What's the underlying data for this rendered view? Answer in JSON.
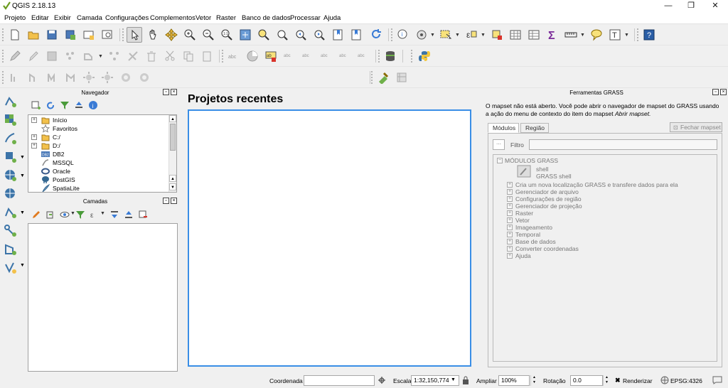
{
  "window": {
    "title": "QGIS 2.18.13",
    "minimize": "—",
    "restore": "❐",
    "close": "✕"
  },
  "menu": [
    "Projeto",
    "Editar",
    "Exibir",
    "Camada",
    "Configurações",
    "Complementos",
    "Vetor",
    "Raster",
    "Banco de dados",
    "Processar",
    "Ajuda"
  ],
  "navegador": {
    "title": "Navegador",
    "items": [
      "Início",
      "Favoritos",
      "C:/",
      "D:/",
      "DB2",
      "MSSQL",
      "Oracle",
      "PostGIS",
      "SpatiaLite"
    ]
  },
  "camadas": {
    "title": "Camadas"
  },
  "recent": {
    "title": "Projetos recentes"
  },
  "grass": {
    "title": "Ferramentas GRASS",
    "description": "O mapset não está aberto. Você pode abrir o navegador de mapset do GRASS usando a ação do menu de contexto do item do mapset",
    "description_link": "Abrir mapset.",
    "tabs": [
      "Módulos",
      "Região"
    ],
    "close_mapset": "Fechar mapset",
    "filter_label": "Filtro",
    "root": "MÓDULOS GRASS",
    "shell_label": "shell",
    "shell_sub": "GRASS shell",
    "modules": [
      "Cria um nova localização GRASS e transfere dados para ela",
      "Gerenciador de arquivo",
      "Configurações de região",
      "Gerenciador de projeção",
      "Raster",
      "Vetor",
      "Imageamento",
      "Temporal",
      "Base de dados",
      "Converter coordenadas",
      "Ajuda"
    ]
  },
  "status": {
    "coord_label": "Coordenada",
    "coord_value": "",
    "scale_label": "Escala",
    "scale_value": "1:32,150,774",
    "zoom_label": "Ampliar",
    "zoom_value": "100%",
    "rotation_label": "Rotação",
    "rotation_value": "0.0",
    "render_label": "Renderizar",
    "crs": "EPSG:4326"
  }
}
